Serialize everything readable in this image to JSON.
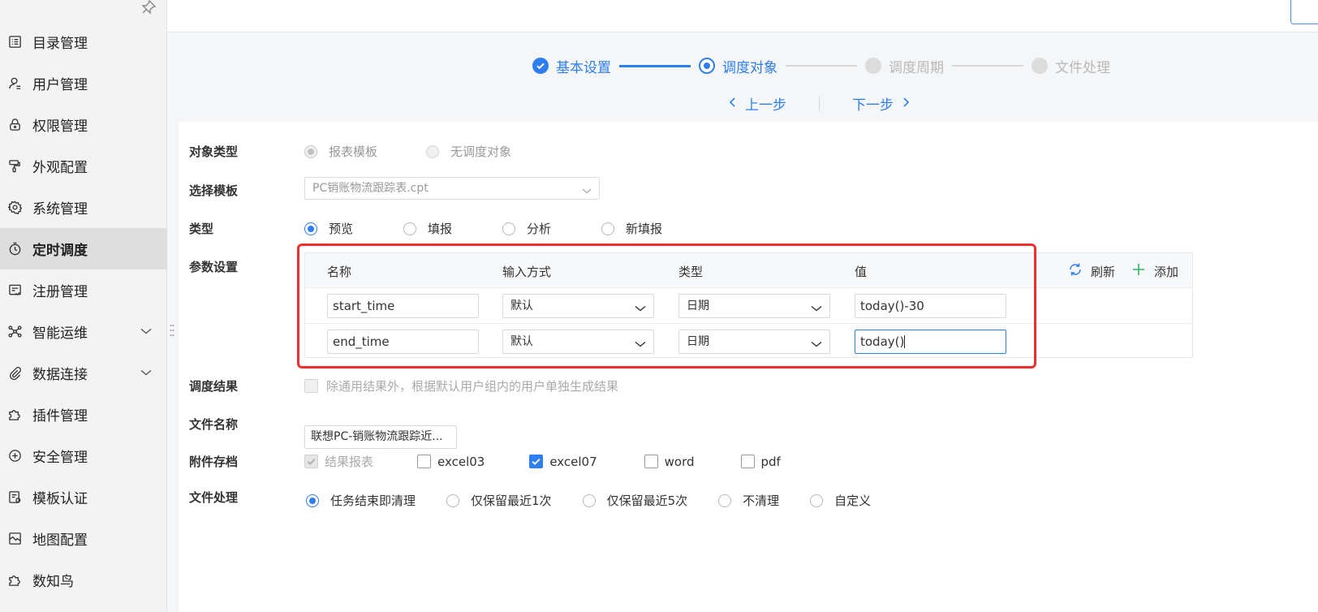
{
  "sidebar": {
    "items": [
      {
        "label": "目录管理",
        "icon": "list-icon"
      },
      {
        "label": "用户管理",
        "icon": "user-icon"
      },
      {
        "label": "权限管理",
        "icon": "lock-icon"
      },
      {
        "label": "外观配置",
        "icon": "paint-roller-icon"
      },
      {
        "label": "系统管理",
        "icon": "gear-icon"
      },
      {
        "label": "定时调度",
        "icon": "clock-icon",
        "active": true
      },
      {
        "label": "注册管理",
        "icon": "register-icon"
      },
      {
        "label": "智能运维",
        "icon": "network-icon",
        "expandable": true
      },
      {
        "label": "数据连接",
        "icon": "paperclip-icon",
        "expandable": true
      },
      {
        "label": "插件管理",
        "icon": "puzzle-icon"
      },
      {
        "label": "安全管理",
        "icon": "shield-icon"
      },
      {
        "label": "模板认证",
        "icon": "certificate-icon"
      },
      {
        "label": "地图配置",
        "icon": "map-icon"
      },
      {
        "label": "数知鸟",
        "icon": "puzzle-icon"
      }
    ]
  },
  "steps": [
    {
      "label": "基本设置",
      "state": "done"
    },
    {
      "label": "调度对象",
      "state": "current"
    },
    {
      "label": "调度周期",
      "state": "todo"
    },
    {
      "label": "文件处理",
      "state": "todo"
    }
  ],
  "nav": {
    "prev": "上一步",
    "next": "下一步"
  },
  "form": {
    "object_type": {
      "label": "对象类型",
      "options": [
        "报表模板",
        "无调度对象"
      ],
      "selected": "报表模板"
    },
    "template": {
      "label": "选择模板",
      "value": "PC销账物流跟踪表.cpt"
    },
    "type": {
      "label": "类型",
      "options": [
        "预览",
        "填报",
        "分析",
        "新填报"
      ],
      "selected": "预览"
    },
    "params": {
      "label": "参数设置",
      "headers": {
        "name": "名称",
        "input": "输入方式",
        "type": "类型",
        "value": "值"
      },
      "refresh": "刷新",
      "add": "添加",
      "rows": [
        {
          "name": "start_time",
          "input": "默认",
          "type": "日期",
          "value": "today()-30"
        },
        {
          "name": "end_time",
          "input": "默认",
          "type": "日期",
          "value": "today()"
        }
      ]
    },
    "result": {
      "label": "调度结果",
      "option": "除通用结果外，根据默认用户组内的用户单独生成结果"
    },
    "filename": {
      "label": "文件名称",
      "value": "联想PC-销账物流跟踪近..."
    },
    "attach": {
      "label": "附件存档",
      "options": [
        "结果报表",
        "excel03",
        "excel07",
        "word",
        "pdf"
      ],
      "checked": [
        "结果报表",
        "excel07"
      ]
    },
    "file_proc": {
      "label": "文件处理",
      "options": [
        "任务结束即清理",
        "仅保留最近1次",
        "仅保留最近5次",
        "不清理",
        "自定义"
      ],
      "selected": "任务结束即清理"
    }
  },
  "colors": {
    "accent": "#2e7ef0",
    "highlight": "#ef2f2f"
  }
}
